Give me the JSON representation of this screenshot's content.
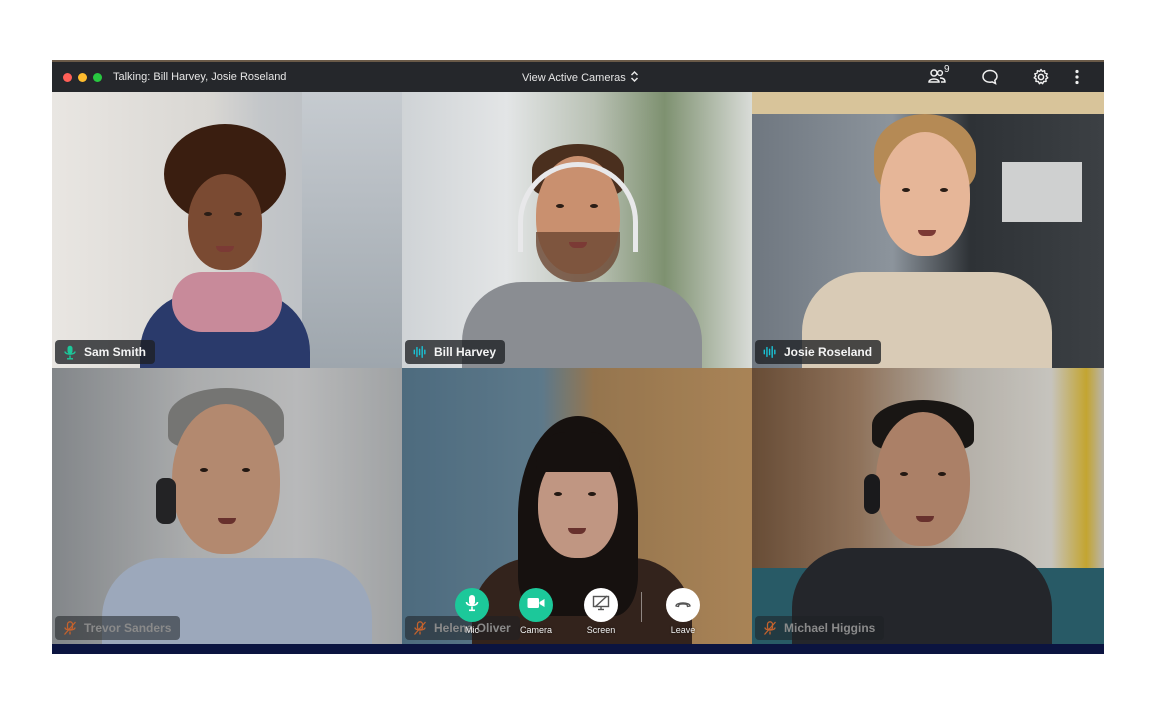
{
  "titlebar": {
    "talking_text": "Talking: Bill Harvey, Josie Roseland",
    "view_selector_label": "View Active Cameras",
    "participants_count": "9",
    "icons": [
      "participants-icon",
      "chat-icon",
      "settings-icon",
      "more-options-icon"
    ]
  },
  "colors": {
    "accent_green": "#1cc89a",
    "speaking_cyan": "#19c3d6",
    "muted_orange": "#c4622d",
    "titlebar_bg": "#25272b"
  },
  "participants": [
    {
      "name": "Sam Smith",
      "audio_state": "unmuted",
      "icon": "mic-icon"
    },
    {
      "name": "Bill Harvey",
      "audio_state": "speaking",
      "icon": "audio-wave-icon"
    },
    {
      "name": "Josie Roseland",
      "audio_state": "speaking",
      "icon": "audio-wave-icon"
    },
    {
      "name": "Trevor Sanders",
      "audio_state": "muted",
      "icon": "mic-muted-icon"
    },
    {
      "name": "Helena Oliver",
      "audio_state": "muted",
      "icon": "mic-muted-icon"
    },
    {
      "name": "Michael Higgins",
      "audio_state": "muted",
      "icon": "mic-muted-icon"
    }
  ],
  "controls": [
    {
      "label": "Mic",
      "icon": "mic-icon",
      "style": "green"
    },
    {
      "label": "Camera",
      "icon": "camera-icon",
      "style": "green"
    },
    {
      "label": "Screen",
      "icon": "screen-share-off-icon",
      "style": "white"
    },
    {
      "label": "Leave",
      "icon": "hang-up-icon",
      "style": "white"
    }
  ]
}
